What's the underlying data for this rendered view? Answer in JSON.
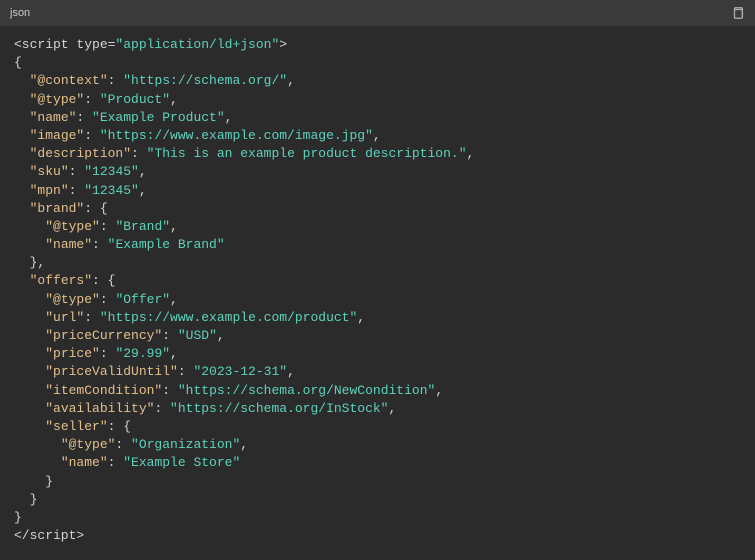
{
  "header": {
    "language": "json"
  },
  "code": {
    "scriptOpen": "<script type=",
    "scriptType": "\"application/ld+json\"",
    "scriptOpenEnd": ">",
    "scriptClose": "</script>",
    "keys": {
      "context": "\"@context\"",
      "type": "\"@type\"",
      "name": "\"name\"",
      "image": "\"image\"",
      "description": "\"description\"",
      "sku": "\"sku\"",
      "mpn": "\"mpn\"",
      "brand": "\"brand\"",
      "offers": "\"offers\"",
      "url": "\"url\"",
      "priceCurrency": "\"priceCurrency\"",
      "price": "\"price\"",
      "priceValidUntil": "\"priceValidUntil\"",
      "itemCondition": "\"itemCondition\"",
      "availability": "\"availability\"",
      "seller": "\"seller\""
    },
    "values": {
      "context": "\"https://schema.org/\"",
      "type": "\"Product\"",
      "name": "\"Example Product\"",
      "image": "\"https://www.example.com/image.jpg\"",
      "description": "\"This is an example product description.\"",
      "sku": "\"12345\"",
      "mpn": "\"12345\"",
      "brandType": "\"Brand\"",
      "brandName": "\"Example Brand\"",
      "offerType": "\"Offer\"",
      "url": "\"https://www.example.com/product\"",
      "priceCurrency": "\"USD\"",
      "price": "\"29.99\"",
      "priceValidUntil": "\"2023-12-31\"",
      "itemCondition": "\"https://schema.org/NewCondition\"",
      "availability": "\"https://schema.org/InStock\"",
      "sellerType": "\"Organization\"",
      "sellerName": "\"Example Store\""
    }
  }
}
